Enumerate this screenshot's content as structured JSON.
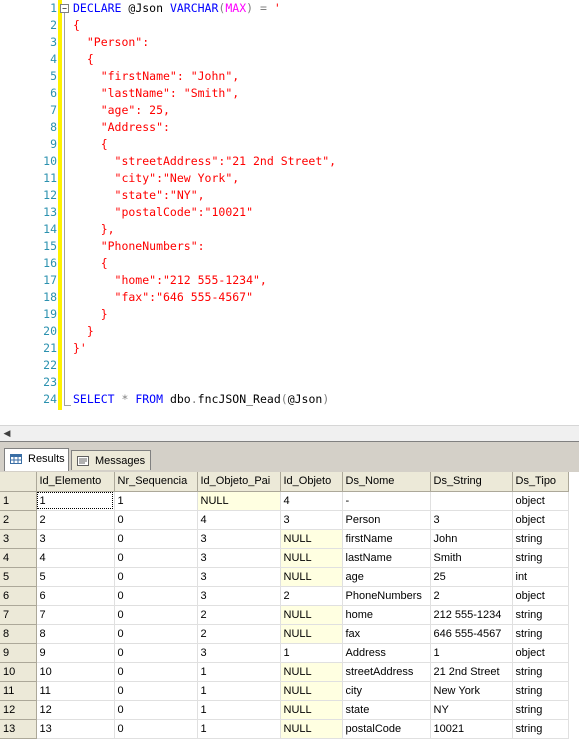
{
  "editor": {
    "lines": [
      {
        "n": "1",
        "tokens": [
          {
            "t": "DECLARE ",
            "c": "kw"
          },
          {
            "t": "@Json ",
            "c": "bk"
          },
          {
            "t": "VARCHAR",
            "c": "kw"
          },
          {
            "t": "(",
            "c": "gr"
          },
          {
            "t": "MAX",
            "c": "fn"
          },
          {
            "t": ")",
            "c": "gr"
          },
          {
            "t": " = ",
            "c": "gr"
          },
          {
            "t": "'",
            "c": "st"
          }
        ]
      },
      {
        "n": "2",
        "tokens": [
          {
            "t": "{",
            "c": "st"
          }
        ]
      },
      {
        "n": "3",
        "tokens": [
          {
            "t": "  \"Person\":",
            "c": "st"
          }
        ]
      },
      {
        "n": "4",
        "tokens": [
          {
            "t": "  {",
            "c": "st"
          }
        ]
      },
      {
        "n": "5",
        "tokens": [
          {
            "t": "    \"firstName\": \"John\",",
            "c": "st"
          }
        ]
      },
      {
        "n": "6",
        "tokens": [
          {
            "t": "    \"lastName\": \"Smith\",",
            "c": "st"
          }
        ]
      },
      {
        "n": "7",
        "tokens": [
          {
            "t": "    \"age\": 25,",
            "c": "st"
          }
        ]
      },
      {
        "n": "8",
        "tokens": [
          {
            "t": "    \"Address\":",
            "c": "st"
          }
        ]
      },
      {
        "n": "9",
        "tokens": [
          {
            "t": "    {",
            "c": "st"
          }
        ]
      },
      {
        "n": "10",
        "tokens": [
          {
            "t": "      \"streetAddress\":\"21 2nd Street\",",
            "c": "st"
          }
        ]
      },
      {
        "n": "11",
        "tokens": [
          {
            "t": "      \"city\":\"New York\",",
            "c": "st"
          }
        ]
      },
      {
        "n": "12",
        "tokens": [
          {
            "t": "      \"state\":\"NY\",",
            "c": "st"
          }
        ]
      },
      {
        "n": "13",
        "tokens": [
          {
            "t": "      \"postalCode\":\"10021\"",
            "c": "st"
          }
        ]
      },
      {
        "n": "14",
        "tokens": [
          {
            "t": "    },",
            "c": "st"
          }
        ]
      },
      {
        "n": "15",
        "tokens": [
          {
            "t": "    \"PhoneNumbers\":",
            "c": "st"
          }
        ]
      },
      {
        "n": "16",
        "tokens": [
          {
            "t": "    {",
            "c": "st"
          }
        ]
      },
      {
        "n": "17",
        "tokens": [
          {
            "t": "      \"home\":\"212 555-1234\",",
            "c": "st"
          }
        ]
      },
      {
        "n": "18",
        "tokens": [
          {
            "t": "      \"fax\":\"646 555-4567\"",
            "c": "st"
          }
        ]
      },
      {
        "n": "19",
        "tokens": [
          {
            "t": "    }",
            "c": "st"
          }
        ]
      },
      {
        "n": "20",
        "tokens": [
          {
            "t": "  }",
            "c": "st"
          }
        ]
      },
      {
        "n": "21",
        "tokens": [
          {
            "t": "}'",
            "c": "st"
          }
        ]
      },
      {
        "n": "22",
        "tokens": []
      },
      {
        "n": "23",
        "tokens": []
      },
      {
        "n": "24",
        "tokens": [
          {
            "t": "SELECT ",
            "c": "kw"
          },
          {
            "t": "* ",
            "c": "gr"
          },
          {
            "t": "FROM ",
            "c": "kw"
          },
          {
            "t": "dbo",
            "c": "bk"
          },
          {
            "t": ".",
            "c": "gr"
          },
          {
            "t": "fncJSON_Read",
            "c": "bk"
          },
          {
            "t": "(",
            "c": "gr"
          },
          {
            "t": "@Json",
            "c": "bk"
          },
          {
            "t": ")",
            "c": "gr"
          }
        ]
      }
    ]
  },
  "tabs": {
    "results_label": "Results",
    "messages_label": "Messages"
  },
  "grid": {
    "columns": [
      "Id_Elemento",
      "Nr_Sequencia",
      "Id_Objeto_Pai",
      "Id_Objeto",
      "Ds_Nome",
      "Ds_String",
      "Ds_Tipo"
    ],
    "rows": [
      [
        "1",
        "1",
        "1",
        "NULL",
        "4",
        "-",
        "",
        "object"
      ],
      [
        "2",
        "2",
        "0",
        "4",
        "3",
        "Person",
        "3",
        "object"
      ],
      [
        "3",
        "3",
        "0",
        "3",
        "NULL",
        "firstName",
        "John",
        "string"
      ],
      [
        "4",
        "4",
        "0",
        "3",
        "NULL",
        "lastName",
        "Smith",
        "string"
      ],
      [
        "5",
        "5",
        "0",
        "3",
        "NULL",
        "age",
        "25",
        "int"
      ],
      [
        "6",
        "6",
        "0",
        "3",
        "2",
        "PhoneNumbers",
        "2",
        "object"
      ],
      [
        "7",
        "7",
        "0",
        "2",
        "NULL",
        "home",
        "212 555-1234",
        "string"
      ],
      [
        "8",
        "8",
        "0",
        "2",
        "NULL",
        "fax",
        "646 555-4567",
        "string"
      ],
      [
        "9",
        "9",
        "0",
        "3",
        "1",
        "Address",
        "1",
        "object"
      ],
      [
        "10",
        "10",
        "0",
        "1",
        "NULL",
        "streetAddress",
        "21 2nd Street",
        "string"
      ],
      [
        "11",
        "11",
        "0",
        "1",
        "NULL",
        "city",
        "New York",
        "string"
      ],
      [
        "12",
        "12",
        "0",
        "1",
        "NULL",
        "state",
        "NY",
        "string"
      ],
      [
        "13",
        "13",
        "0",
        "1",
        "NULL",
        "postalCode",
        "10021",
        "string"
      ]
    ]
  },
  "colors": {
    "keyword": "#0000ff",
    "string": "#ff0000",
    "line_number": "#2b91af",
    "null_cell_bg": "#ffffe1",
    "header_bg": "#ece9d8"
  },
  "icons": {
    "results_tab": "grid-icon",
    "messages_tab": "messages-icon",
    "scroll_left": "arrow-left-icon"
  }
}
